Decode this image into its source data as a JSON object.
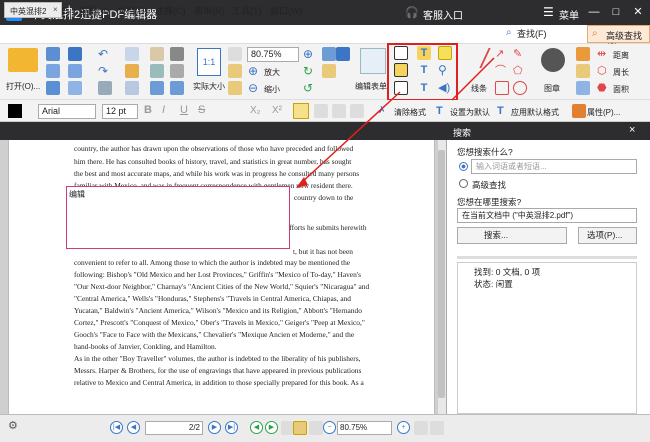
{
  "app": {
    "title": "中英混排2迅捷PDF编辑器",
    "logo_letter": "P",
    "customer_label": "客服入口",
    "menu_label": "菜单",
    "window_buttons": [
      "—",
      "□",
      "✕"
    ]
  },
  "menubar": {
    "items": [
      "文件",
      "编辑(E)",
      "视图(V)",
      "文档(D)",
      "注释(C)",
      "表单(R)",
      "工具(T)",
      "窗口(W)"
    ],
    "find_label": "查找(F)",
    "advanced_find_label": "高级查找(S)"
  },
  "toolbar": {
    "open_label": "打开(O)...",
    "zoom_value": "80.75%",
    "actual_size_label": "实际大小",
    "zoom_in_label": "放大",
    "zoom_out_label": "缩小",
    "edit_form_label": "编辑表单",
    "lines_label": "线条",
    "stamp_label": "图章",
    "distance_label": "距离",
    "perimeter_label": "周长",
    "area_label": "面积"
  },
  "formatbar": {
    "font_name": "Arial",
    "font_size": "12 pt",
    "bold": "B",
    "italic": "I",
    "underline": "U",
    "strike": "S",
    "subscript": "X₂",
    "superscript": "X²",
    "clear_format_label": "清除格式",
    "set_default_label": "设置为默认",
    "apply_default_label": "应用默认格式",
    "properties_label": "属性(P)..."
  },
  "tabs": {
    "doc_tab_label": "中英混排2",
    "close": "×",
    "add": "+"
  },
  "document": {
    "lines_top": [
      "country, the author has drawn upon the observations of those who have preceded and followed",
      "him there. He has consulted books of history, travel, and statistics in great number, has sought",
      "the best and most accurate maps, and while his work was in progress he consulted many persons",
      "familiar with Mexico, and was in frequent correspondence with gentlemen now resident there."
    ],
    "partial_right_1": "country down to the",
    "partial_right_2": "efforts he submits herewith",
    "lines_bottom": [
      "convenient to refer to all. Among those to which the author is indebted may be mentioned the",
      "following: Bishop's \"Old Mexico and her Lost Provinces,\" Griffin's \"Mexico of To-day,\" Haven's",
      "\"Our Next-door Neighbor,\" Charnay's \"Ancient Cities of the New World,\" Squier's \"Nicaragua\" and",
      "\"Central America,\" Wells's \"Honduras,\" Stephens's \"Travels in Central America, Chiapas, and",
      "Yucatan,\" Baldwin's \"Ancient America,\" Wilson's \"Mexico and its Religion,\" Abbott's \"Hernando",
      "Cortez,\" Prescott's \"Conquest of Mexico,\" Ober's \"Travels in Mexico,\" Geiger's \"Peep at Mexico,\"",
      "Gooch's \"Face to Face with the Mexicans,\" Chevalier's \"Mexique Ancien et Moderne,\" and the",
      "hand-books of Janvier, Conkling, and Hamilton.",
      "As in the other \"Boy Traveller\" volumes, the author is indebted to the liberality of his publishers,",
      "Messrs. Harper & Brothers, for the use of engravings that have appeared in previous publications",
      "relative to Mexico and Central America, in addition to those specially prepared for this book. As a"
    ],
    "partial_mid": "t, but it has not been",
    "edit_box_text": "编辑"
  },
  "search_panel": {
    "title": "搜索",
    "what_label": "您想搜索什么?",
    "search_placeholder": "输入词语或者短语...",
    "advanced_label": "高级查找",
    "where_label": "您想在哪里搜索?",
    "where_value": "在当前文档中 (\"中英混排2.pdf\")",
    "search_button": "搜索...",
    "options_button": "选项(P)...",
    "found_label": "找到: 0 文档, 0 项",
    "status_label": "状态: 闲置"
  },
  "statusbar": {
    "page_value": "2",
    "page_total": "2",
    "zoom_value": "80.75%"
  },
  "colors": {
    "titlebar": "#2d2d30",
    "accent_blue": "#3a76c4",
    "annotation_red": "#e02020",
    "search_tab": "#fde9d6"
  }
}
